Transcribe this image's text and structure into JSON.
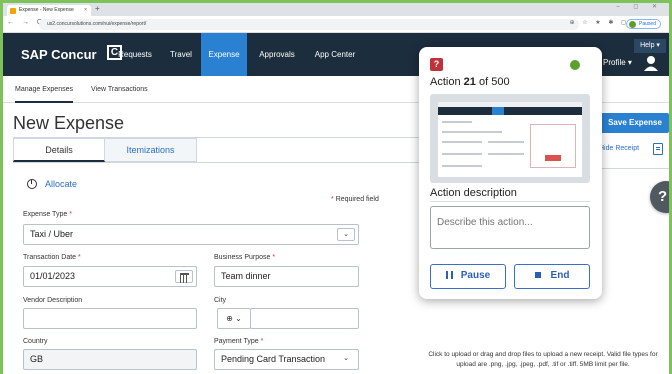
{
  "browser": {
    "tab_title": "Expense - New Expense",
    "tab_close": "×",
    "new_tab": "+",
    "window_controls": "–  ◻  ✕",
    "nav_buttons": "← → C",
    "url": "us2.concursolutions.com/nui/expense/report/",
    "extension_icons": "⊕ ☆ ★ ✱ ◻",
    "profile_state": "Paused"
  },
  "app": {
    "logo_text": "SAP Concur",
    "logo_box": "C",
    "nav": [
      "Requests",
      "Travel",
      "Expense",
      "Approvals",
      "App Center"
    ],
    "active_nav": "Expense",
    "profile_label": "Profile ▾",
    "help_label": "Help ▾"
  },
  "subnav": {
    "items": [
      "Manage Expenses",
      "View Transactions"
    ]
  },
  "page": {
    "title": "New Expense",
    "save_button": "Save Expense",
    "hide_receipt": "Hide Receipt"
  },
  "tabs": {
    "details": "Details",
    "itemizations": "Itemizations"
  },
  "form": {
    "allocate": "Allocate",
    "required_note": "Required field",
    "required_star": "*",
    "expense_type_label": "Expense Type",
    "expense_type_value": "Taxi / Uber",
    "transaction_date_label": "Transaction Date",
    "transaction_date_value": "01/01/2023",
    "business_purpose_label": "Business Purpose",
    "business_purpose_value": "Team dinner",
    "vendor_label": "Vendor Description",
    "vendor_value": "",
    "city_label": "City",
    "city_value": "",
    "country_label": "Country",
    "country_value": "GB",
    "payment_type_label": "Payment Type",
    "payment_type_value": "Pending Card Transaction",
    "dropdown_glyph": "⌄",
    "globe_glyph": "⊕ ⌄",
    "upload_text": "Click to upload or drag and drop files to upload a new receipt. Valid file types for upload are .png, .jpg, .jpeg, .pdf, .tif or .tiff. 5MB limit per file."
  },
  "panel": {
    "logo_glyph": "?",
    "action_word": "Action",
    "action_current": "21",
    "action_of": "of",
    "action_total": "500",
    "description_title": "Action description",
    "description_placeholder": "Describe this action...",
    "pause_label": "Pause",
    "end_label": "End",
    "status_color": "#5aa02c"
  },
  "fab": {
    "glyph": "?"
  }
}
